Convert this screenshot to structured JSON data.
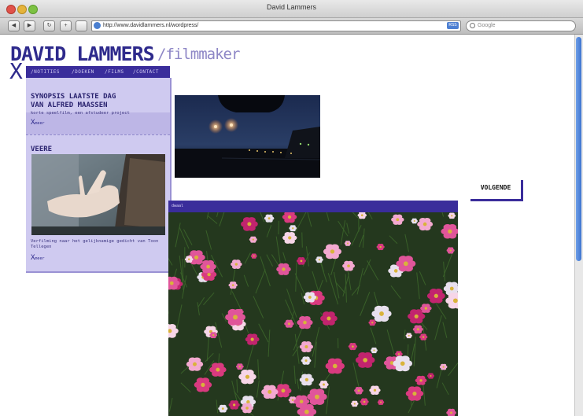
{
  "window": {
    "title": "David Lammers"
  },
  "toolbar": {
    "back_label": "◀",
    "forward_label": "▶",
    "reload_label": "↻",
    "add_label": "+",
    "url": "http://www.davidlammers.nl/wordpress/",
    "rss_label": "RSS",
    "search_placeholder": "Google"
  },
  "site": {
    "title": "DAVID LAMMERS",
    "subtitle": "/filmmaker",
    "logo_mark": "X"
  },
  "nav": {
    "items": [
      "/NOTITIES",
      "/DOEKEN",
      "/FILMS",
      "/CONTACT"
    ]
  },
  "posts": [
    {
      "title_line1": "SYNOPSIS LAATSTE DAG",
      "title_line2": "VAN ALFRED MAASSEN",
      "excerpt": "korte speelfilm, een afstudeer project",
      "more": "meer"
    },
    {
      "title_line1": "VEERE",
      "excerpt": "Verfilming naar het gelijknamige gedicht van Toon Tellegen",
      "more": "meer"
    }
  ],
  "gallery": {
    "bar_label": "dwaal",
    "next_label": "VOLGENDE"
  },
  "colors": {
    "brand": "#2e2a8c",
    "nav_bg": "#3a2d9b",
    "panel_bg": "#cfcaf0"
  }
}
